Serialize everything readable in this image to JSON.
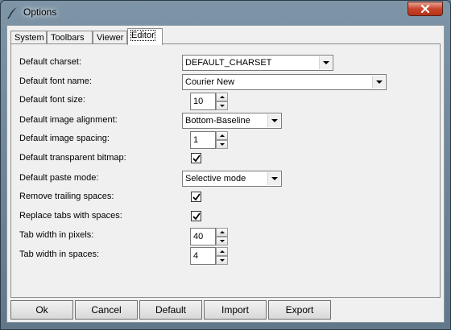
{
  "window": {
    "title": "Options",
    "icon": "feather-icon",
    "close_icon": "close-x-icon"
  },
  "tabs": [
    {
      "label": "System",
      "active": false
    },
    {
      "label": "Toolbars",
      "active": false
    },
    {
      "label": "Viewer",
      "active": false
    },
    {
      "label": "Editor",
      "active": true
    }
  ],
  "editor": {
    "charset": {
      "label": "Default charset:",
      "value": "DEFAULT_CHARSET"
    },
    "font_name": {
      "label": "Default font name:",
      "value": "Courier New"
    },
    "font_size": {
      "label": "Default font size:",
      "value": "10"
    },
    "image_alignment": {
      "label": "Default image alignment:",
      "value": "Bottom-Baseline"
    },
    "image_spacing": {
      "label": "Default image spacing:",
      "value": "1"
    },
    "transparent_bitmap": {
      "label": "Default transparent bitmap:",
      "checked": true
    },
    "paste_mode": {
      "label": "Default paste mode:",
      "value": "Selective mode"
    },
    "remove_trailing": {
      "label": "Remove trailing spaces:",
      "checked": true
    },
    "replace_tabs": {
      "label": "Replace tabs with spaces:",
      "checked": true
    },
    "tab_width_pixels": {
      "label": "Tab width in pixels:",
      "value": "40"
    },
    "tab_width_spaces": {
      "label": "Tab width in spaces:",
      "value": "4"
    }
  },
  "buttons": {
    "ok": "Ok",
    "cancel": "Cancel",
    "default": "Default",
    "import": "Import",
    "export": "Export"
  }
}
